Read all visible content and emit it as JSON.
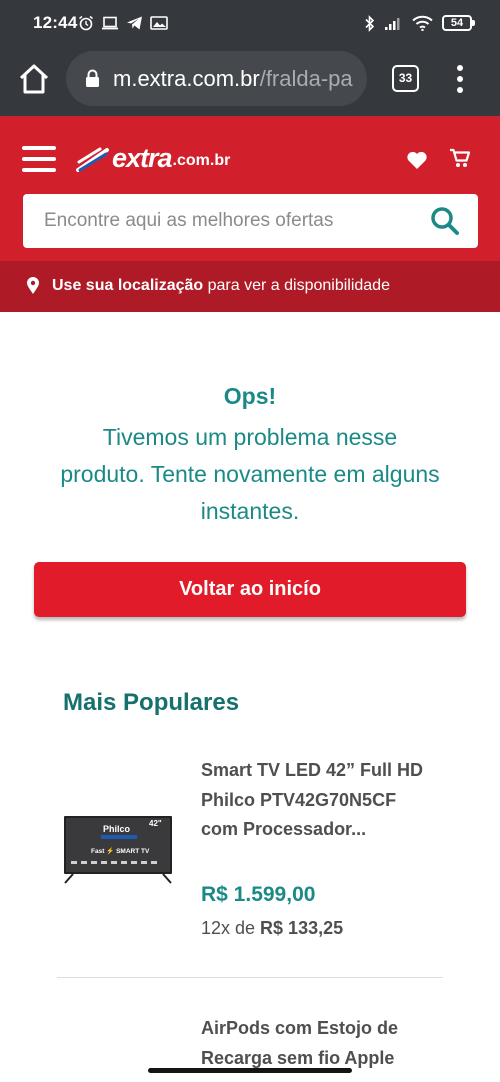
{
  "status_bar": {
    "time": "12:44",
    "battery": "54"
  },
  "browser": {
    "url_domain": "m.extra.com.br",
    "url_path": "/fralda-pa",
    "tab_count": "33"
  },
  "header": {
    "logo_text": "extra",
    "logo_domain": ".com.br",
    "search_placeholder": "Encontre aqui as melhores ofertas",
    "location_bold": "Use sua localização",
    "location_rest": " para ver a disponibilidade"
  },
  "error": {
    "title": "Ops!",
    "message": "Tivemos um problema nesse produto. Tente novamente em alguns instantes.",
    "button": "Voltar ao inicío"
  },
  "popular": {
    "title": "Mais Populares",
    "products": [
      {
        "name": "Smart TV LED 42” Full HD Philco PTV42G70N5CF com Processador...",
        "price": "R$ 1.599,00",
        "installment_prefix": "12x de ",
        "installment_value": "R$ 133,25",
        "thumb_brand": "Philco",
        "thumb_size": "42\"",
        "thumb_tag": "Fast ⚡ SMART TV"
      },
      {
        "name": "AirPods com Estojo de Recarga sem fio Apple"
      }
    ]
  },
  "colors": {
    "brand_red": "#d21f2c",
    "location_red": "#ae1b27",
    "teal": "#1b8a86",
    "chrome": "#35383d"
  }
}
